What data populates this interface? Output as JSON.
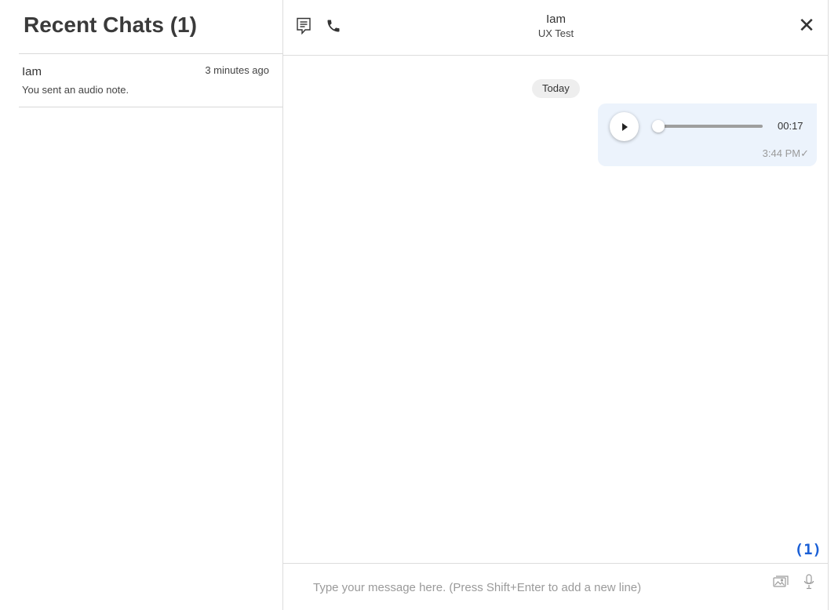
{
  "sidebar": {
    "title": "Recent Chats (1)",
    "chats": [
      {
        "name": "Iam",
        "time": "3 minutes ago",
        "preview": "You sent an audio note."
      }
    ]
  },
  "header": {
    "contact_name": "Iam",
    "subtitle": "UX Test",
    "icons": {
      "transcript": "transcript-icon",
      "phone": "phone-icon",
      "close": "close-icon"
    },
    "close_glyph": "✕"
  },
  "messages": {
    "date_label": "Today",
    "items": [
      {
        "type": "audio",
        "duration": "00:17",
        "progress": 0,
        "time": "3:44 PM",
        "status_glyph": "✓"
      }
    ]
  },
  "unread_indicator": "(1)",
  "composer": {
    "placeholder": "Type your message here. (Press Shift+Enter to add a new line)",
    "value": "",
    "icons": {
      "image": "image-icon",
      "mic": "microphone-icon"
    }
  },
  "colors": {
    "bubble_bg": "#ecf3fc",
    "accent": "#1a5fd6",
    "pill_bg": "#eeeeee",
    "divider": "#dcdcdc"
  }
}
